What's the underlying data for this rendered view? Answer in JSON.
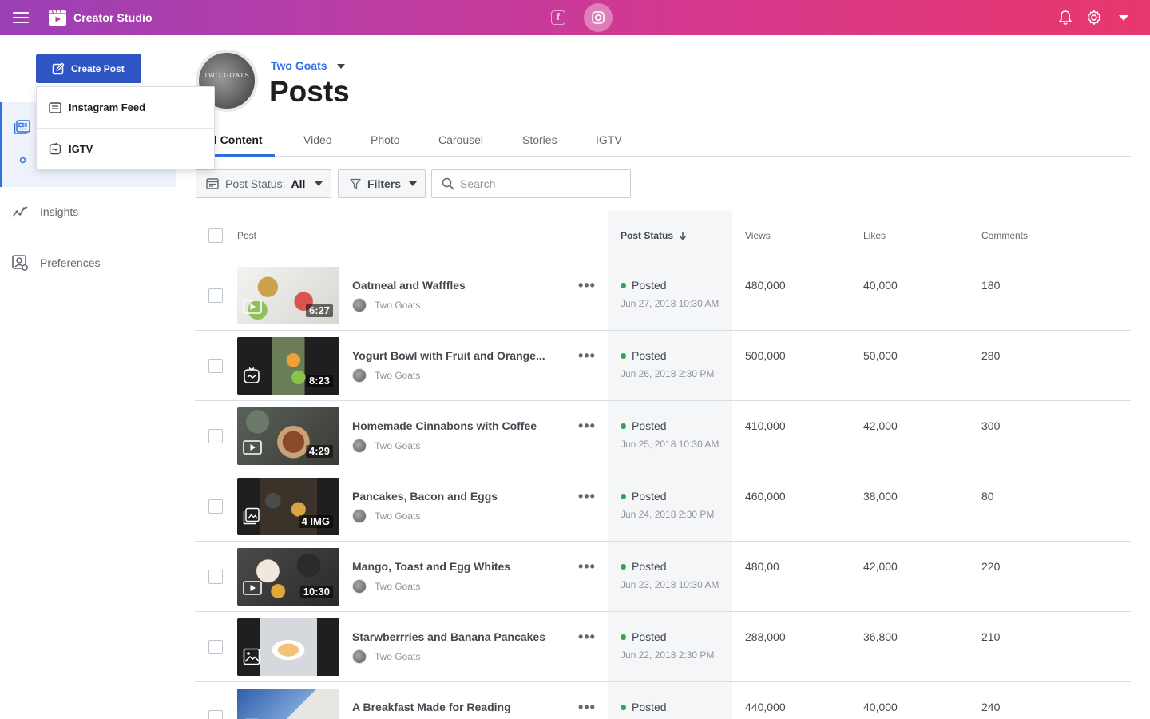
{
  "app": {
    "title": "Creator Studio"
  },
  "colors": {
    "accent": "#2f6fde",
    "create_button": "#2f55c4",
    "posted_dot": "#2fa84f",
    "header_gradient_start": "#9b3fb5",
    "header_gradient_end": "#e8386d"
  },
  "topbar": {
    "facebook_label": "f"
  },
  "sidebar": {
    "create_button": "Create Post",
    "items": [
      {
        "label": "Insights",
        "icon": "insights-icon"
      },
      {
        "label": "Preferences",
        "icon": "preferences-icon"
      }
    ]
  },
  "create_menu": {
    "items": [
      "Instagram Feed",
      "IGTV"
    ]
  },
  "account": {
    "name": "Two Goats",
    "avatar_text": "TWO GOATS"
  },
  "page": {
    "title": "Posts"
  },
  "tabs": [
    "ll Content",
    "Video",
    "Photo",
    "Carousel",
    "Stories",
    "IGTV"
  ],
  "filters": {
    "post_status_label": "Post Status:",
    "post_status_value": "All",
    "filters_label": "Filters",
    "search_placeholder": "Search"
  },
  "table": {
    "columns": {
      "post": "Post",
      "status": "Post Status",
      "views": "Views",
      "likes": "Likes",
      "comments": "Comments"
    },
    "rows": [
      {
        "title": "Oatmeal and Wafffles",
        "author": "Two Goats",
        "badge": "6:27",
        "type": "video",
        "status": "Posted",
        "date": "Jun 27, 2018 10:30 AM",
        "views": "480,000",
        "likes": "40,000",
        "comments": "180"
      },
      {
        "title": "Yogurt Bowl with Fruit and Orange...",
        "author": "Two Goats",
        "badge": "8:23",
        "type": "igtv",
        "status": "Posted",
        "date": "Jun 26, 2018 2:30 PM",
        "views": "500,000",
        "likes": "50,000",
        "comments": "280"
      },
      {
        "title": "Homemade Cinnabons with Coffee",
        "author": "Two Goats",
        "badge": "4:29",
        "type": "video",
        "status": "Posted",
        "date": "Jun 25, 2018 10:30 AM",
        "views": "410,000",
        "likes": "42,000",
        "comments": "300"
      },
      {
        "title": "Pancakes, Bacon and Eggs",
        "author": "Two Goats",
        "badge": "4 IMG",
        "type": "carousel",
        "status": "Posted",
        "date": "Jun 24, 2018 2:30 PM",
        "views": "460,000",
        "likes": "38,000",
        "comments": "80"
      },
      {
        "title": "Mango, Toast and Egg Whites",
        "author": "Two Goats",
        "badge": "10:30",
        "type": "video",
        "status": "Posted",
        "date": "Jun 23, 2018 10:30 AM",
        "views": "480,00",
        "likes": "42,000",
        "comments": "220"
      },
      {
        "title": "Starwberrries and Banana Pancakes",
        "author": "Two Goats",
        "badge": "",
        "type": "photo",
        "status": "Posted",
        "date": "Jun 22, 2018 2:30 PM",
        "views": "288,000",
        "likes": "36,800",
        "comments": "210"
      },
      {
        "title": "A Breakfast Made for Reading",
        "author": "Two Goats",
        "badge": "",
        "type": "photo",
        "status": "Posted",
        "date": "",
        "views": "440,000",
        "likes": "40,000",
        "comments": "240"
      }
    ]
  }
}
